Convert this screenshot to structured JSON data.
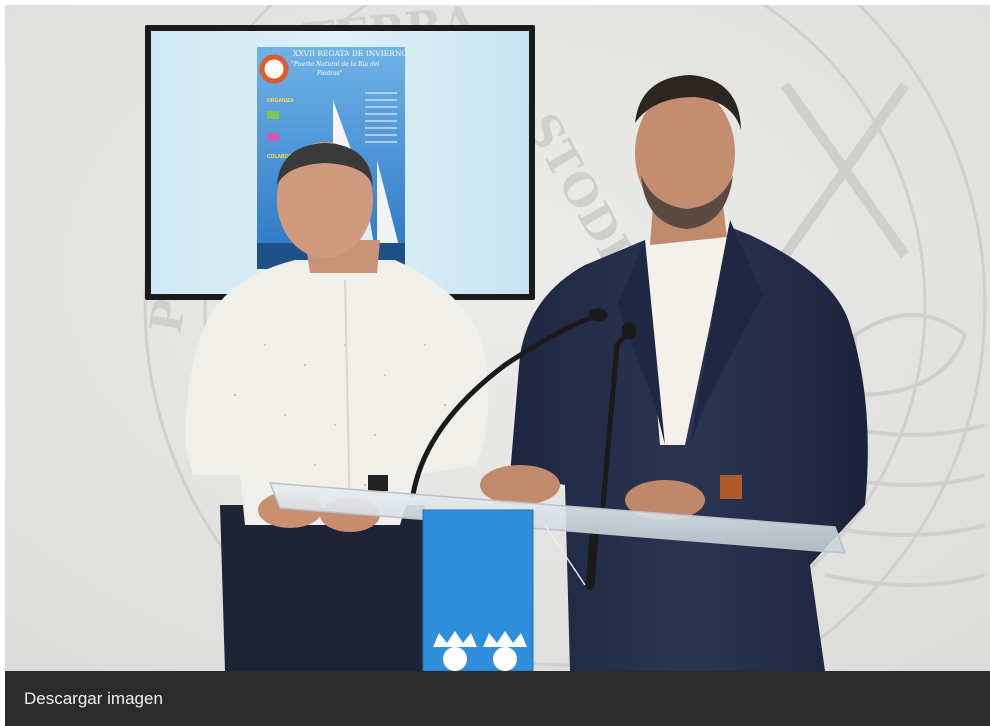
{
  "photo": {
    "poster": {
      "title": "XXVII REGATA DE INVIERNO",
      "subtitle_line1": "\"Puerto Natural de la Ría del",
      "subtitle_line2": "Piedras\"",
      "section_organiza": "ORGANIZA",
      "section_colabora": "COLABORA"
    },
    "wall_text": {
      "arc_top": "TERRA",
      "arc_right": "STODIA",
      "arc_left": "P"
    }
  },
  "caption": {
    "download_label": "Descargar imagen"
  },
  "colors": {
    "wall": "#e6e6e4",
    "caption_bar": "#2b2b2b",
    "podium_panel": "#2f8fdc",
    "jacket": "#222b45"
  }
}
